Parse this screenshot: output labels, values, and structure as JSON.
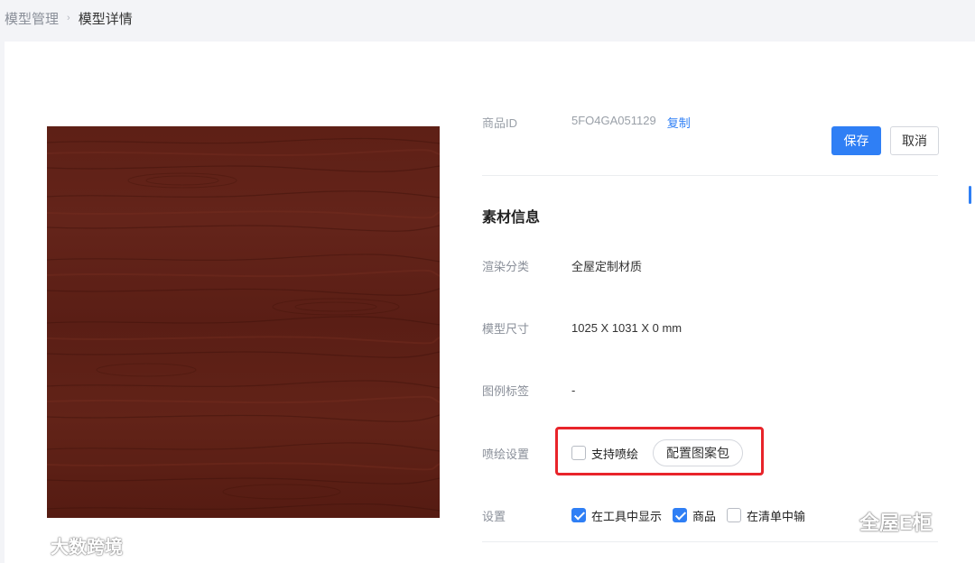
{
  "breadcrumb": {
    "parent": "模型管理",
    "separator": "›",
    "current": "模型详情"
  },
  "product": {
    "id_label": "商品ID",
    "id_value": "5FO4GA051129",
    "copy_label": "复制"
  },
  "actions": {
    "save": "保存",
    "cancel": "取消"
  },
  "section": {
    "title": "素材信息"
  },
  "fields": {
    "render_category": {
      "label": "渲染分类",
      "value": "全屋定制材质"
    },
    "model_size": {
      "label": "模型尺寸",
      "value": "1025 X 1031 X 0 mm"
    },
    "legend_tag": {
      "label": "图例标签",
      "value": "-"
    },
    "spray": {
      "label": "喷绘设置",
      "checkbox_label": "支持喷绘",
      "checked": false,
      "pattern_button": "配置图案包"
    },
    "settings": {
      "label": "设置",
      "options": [
        {
          "label": "在工具中显示",
          "checked": true
        },
        {
          "label": "商品",
          "checked": true
        },
        {
          "label": "在清单中输",
          "checked": false
        }
      ]
    }
  },
  "watermarks": {
    "left": "大数跨境",
    "right": "全屋E柜"
  },
  "colors": {
    "accent": "#2f7ff5",
    "highlight_border": "#e8242a",
    "wood_base": "#5a1d15"
  }
}
